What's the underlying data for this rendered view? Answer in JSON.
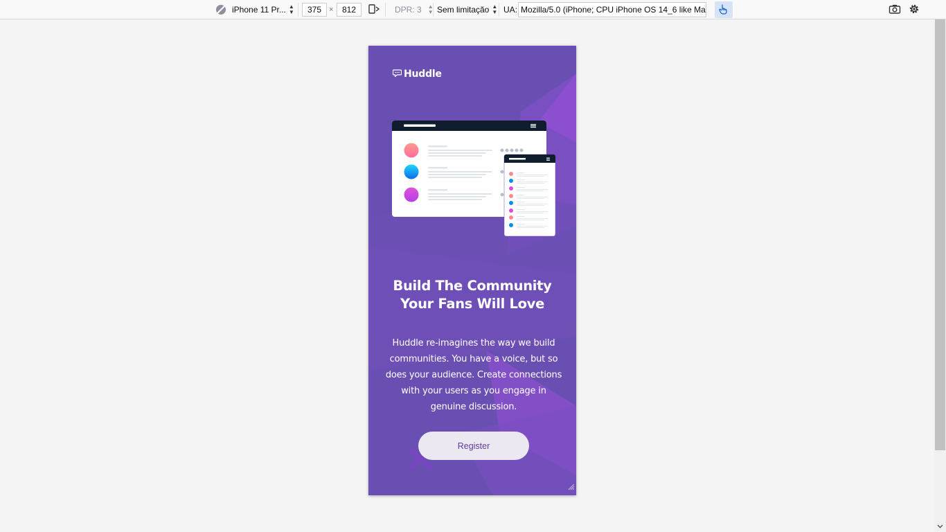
{
  "toolbar": {
    "device_name": "iPhone 11 Pr...",
    "width": "375",
    "times": "×",
    "height": "812",
    "dpr_label": "DPR: 3",
    "throttle": "Sem limitação",
    "ua_label": "UA:",
    "ua_value": "Mozilla/5.0 (iPhone; CPU iPhone OS 14_6 like Mac"
  },
  "page": {
    "brand": "Huddle",
    "heading_line1": "Build The Community",
    "heading_line2": "Your Fans Will Love",
    "description": "Huddle re-imagines the way we build communities. You have a voice, but so does your audience. Create connections with your users as you engage in genuine discussion.",
    "register_label": "Register"
  },
  "colors": {
    "brand_violet": "#6a4fb3",
    "accent_magenta": "#8e4fcc",
    "button_text": "#5d3b9c",
    "button_bg": "#ebe8f1",
    "touch_highlight": "#d7e4f7"
  },
  "icons": [
    "no-throttle-circle-icon",
    "rotate-device-icon",
    "touch-hand-icon",
    "screenshot-camera-icon",
    "settings-gear-icon",
    "chat-bubble-logo-icon",
    "resize-grip-icon"
  ]
}
